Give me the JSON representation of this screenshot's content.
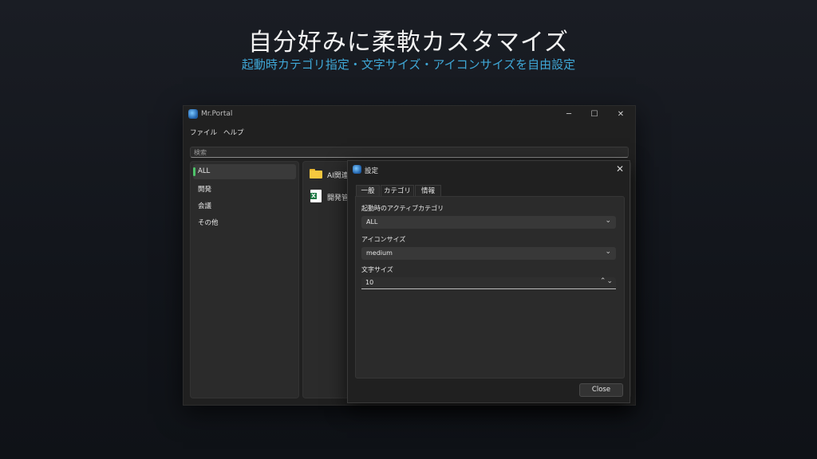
{
  "promo": {
    "headline": "自分好みに柔軟カスタマイズ",
    "subhead": "起動時カテゴリ指定・文字サイズ・アイコンサイズを自由設定"
  },
  "window": {
    "title": "Mr.Portal",
    "controls": {
      "minimize": "─",
      "maximize": "☐",
      "close": "✕"
    }
  },
  "menu": {
    "file": "ファイル",
    "help": "ヘルプ"
  },
  "search": {
    "placeholder": "検索"
  },
  "sidebar": {
    "items": [
      {
        "label": "ALL",
        "active": true
      },
      {
        "label": "開発"
      },
      {
        "label": "会議"
      },
      {
        "label": "その他"
      }
    ]
  },
  "content": {
    "items": [
      {
        "label": "AI関連",
        "icon": "folder-icon"
      },
      {
        "label": "開発管",
        "icon": "excel-icon"
      }
    ]
  },
  "settings": {
    "title": "設定",
    "close_glyph": "✕",
    "tabs": [
      {
        "label": "一般",
        "active": true
      },
      {
        "label": "カテゴリ"
      },
      {
        "label": "情報"
      }
    ],
    "startup_category": {
      "label": "起動時のアクティブカテゴリ",
      "value": "ALL"
    },
    "icon_size": {
      "label": "アイコンサイズ",
      "value": "medium"
    },
    "font_size": {
      "label": "文字サイズ",
      "value": "10"
    },
    "close_button": "Close"
  },
  "colors": {
    "accent_green": "#4ec46a",
    "subhead_blue": "#3fa7d6",
    "folder_yellow": "#f6c83f",
    "excel_green": "#1e7a45"
  }
}
